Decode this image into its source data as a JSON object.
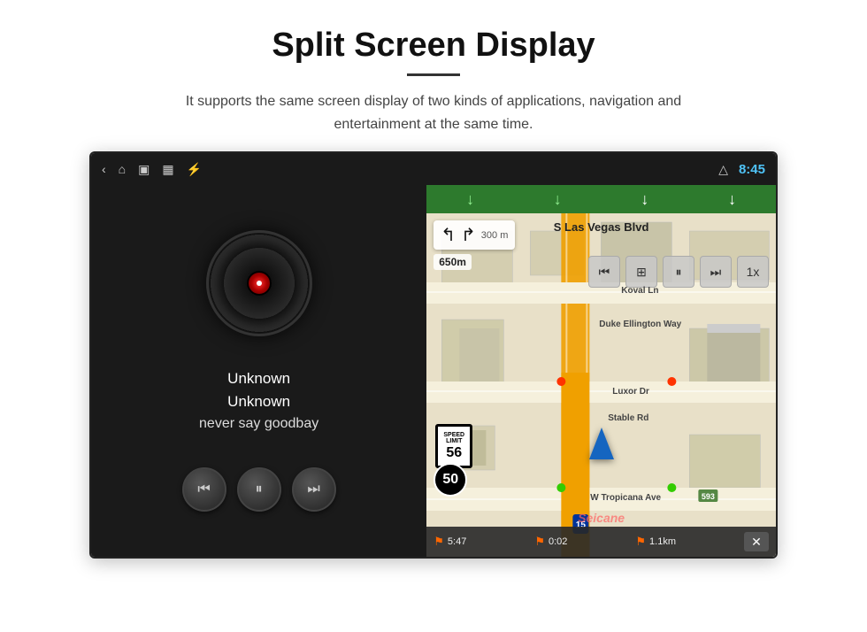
{
  "page": {
    "title": "Split Screen Display",
    "divider": "—",
    "subtitle": "It supports the same screen display of two kinds of applications, navigation and entertainment at the same time."
  },
  "status_bar": {
    "back_icon": "‹",
    "home_icon": "⌂",
    "recents_icon": "▣",
    "gallery_icon": "▦",
    "usb_icon": "⚡",
    "eject_icon": "△",
    "time": "8:45"
  },
  "media_player": {
    "track_label": "Unknown",
    "artist_label": "Unknown",
    "song_label": "never say goodbay",
    "prev_icon": "⏮",
    "play_pause_icon": "⏸",
    "next_icon": "⏭"
  },
  "navigation": {
    "street_name": "S Las Vegas Blvd",
    "turn_distance": "300 m",
    "distance_650": "650m",
    "road_labels": [
      "Koval Ln",
      "Duke Ellington Way",
      "Luxor Dr",
      "Stable Rd",
      "W Tropicana Ave",
      "Vegas Blvd"
    ],
    "speed_limit": {
      "text": "SPEED LIMIT",
      "number": "56"
    },
    "bottom_speed": "50",
    "route_number": "15",
    "distance_remaining": "1.1km",
    "time_elapsed": "0:02",
    "eta": "5:47",
    "speed_multiplier": "1x",
    "close_btn": "✕",
    "top_arrows": [
      "↓",
      "↓",
      "↓",
      "↓"
    ]
  },
  "watermark": {
    "text": "Seicane"
  }
}
